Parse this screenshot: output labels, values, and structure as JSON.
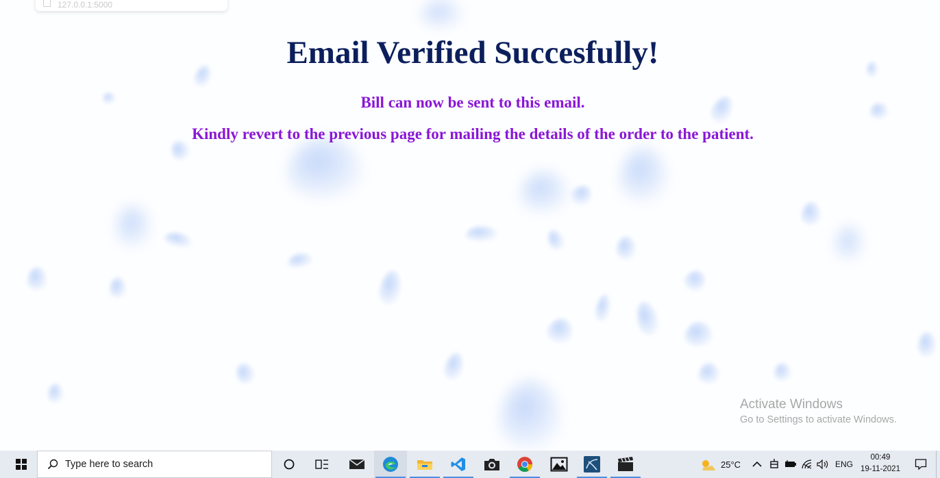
{
  "browser": {
    "url_hint": "127.0.0.1:5000"
  },
  "page": {
    "title": "Email Verified Succesfully!",
    "line1": "Bill can now be sent to this email.",
    "line2": "Kindly revert to the previous page for mailing the details of the order to the patient."
  },
  "watermark": {
    "title": "Activate Windows",
    "subtitle": "Go to Settings to activate Windows."
  },
  "taskbar": {
    "search_placeholder": "Type here to search",
    "apps": [
      "cortana-icon",
      "task-view-icon",
      "mail-icon",
      "edge-icon",
      "file-explorer-icon",
      "vscode-icon",
      "camera-icon",
      "chrome-icon",
      "photos-icon",
      "sql-workbench-icon",
      "video-editor-icon"
    ],
    "weather": "25°C",
    "language": "ENG",
    "time": "00:49",
    "date": "19-11-2021"
  },
  "colors": {
    "title": "#0c1f5c",
    "subtitle": "#8a16d6",
    "taskbar": "#e6eaf1"
  }
}
